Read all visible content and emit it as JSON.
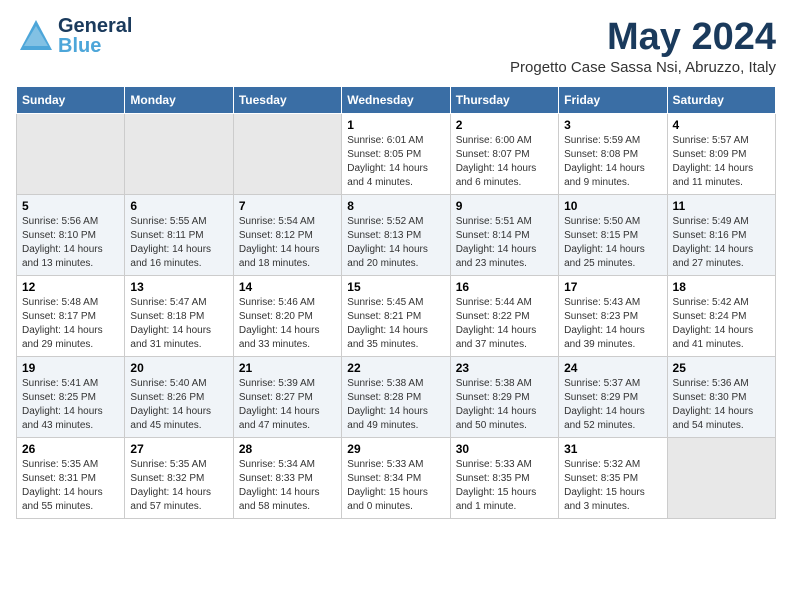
{
  "header": {
    "logo_general": "General",
    "logo_blue": "Blue",
    "month_title": "May 2024",
    "subtitle": "Progetto Case Sassa Nsi, Abruzzo, Italy"
  },
  "weekdays": [
    "Sunday",
    "Monday",
    "Tuesday",
    "Wednesday",
    "Thursday",
    "Friday",
    "Saturday"
  ],
  "weeks": [
    [
      {
        "day": "",
        "sunrise": "",
        "sunset": "",
        "daylight": ""
      },
      {
        "day": "",
        "sunrise": "",
        "sunset": "",
        "daylight": ""
      },
      {
        "day": "",
        "sunrise": "",
        "sunset": "",
        "daylight": ""
      },
      {
        "day": "1",
        "sunrise": "Sunrise: 6:01 AM",
        "sunset": "Sunset: 8:05 PM",
        "daylight": "Daylight: 14 hours and 4 minutes."
      },
      {
        "day": "2",
        "sunrise": "Sunrise: 6:00 AM",
        "sunset": "Sunset: 8:07 PM",
        "daylight": "Daylight: 14 hours and 6 minutes."
      },
      {
        "day": "3",
        "sunrise": "Sunrise: 5:59 AM",
        "sunset": "Sunset: 8:08 PM",
        "daylight": "Daylight: 14 hours and 9 minutes."
      },
      {
        "day": "4",
        "sunrise": "Sunrise: 5:57 AM",
        "sunset": "Sunset: 8:09 PM",
        "daylight": "Daylight: 14 hours and 11 minutes."
      }
    ],
    [
      {
        "day": "5",
        "sunrise": "Sunrise: 5:56 AM",
        "sunset": "Sunset: 8:10 PM",
        "daylight": "Daylight: 14 hours and 13 minutes."
      },
      {
        "day": "6",
        "sunrise": "Sunrise: 5:55 AM",
        "sunset": "Sunset: 8:11 PM",
        "daylight": "Daylight: 14 hours and 16 minutes."
      },
      {
        "day": "7",
        "sunrise": "Sunrise: 5:54 AM",
        "sunset": "Sunset: 8:12 PM",
        "daylight": "Daylight: 14 hours and 18 minutes."
      },
      {
        "day": "8",
        "sunrise": "Sunrise: 5:52 AM",
        "sunset": "Sunset: 8:13 PM",
        "daylight": "Daylight: 14 hours and 20 minutes."
      },
      {
        "day": "9",
        "sunrise": "Sunrise: 5:51 AM",
        "sunset": "Sunset: 8:14 PM",
        "daylight": "Daylight: 14 hours and 23 minutes."
      },
      {
        "day": "10",
        "sunrise": "Sunrise: 5:50 AM",
        "sunset": "Sunset: 8:15 PM",
        "daylight": "Daylight: 14 hours and 25 minutes."
      },
      {
        "day": "11",
        "sunrise": "Sunrise: 5:49 AM",
        "sunset": "Sunset: 8:16 PM",
        "daylight": "Daylight: 14 hours and 27 minutes."
      }
    ],
    [
      {
        "day": "12",
        "sunrise": "Sunrise: 5:48 AM",
        "sunset": "Sunset: 8:17 PM",
        "daylight": "Daylight: 14 hours and 29 minutes."
      },
      {
        "day": "13",
        "sunrise": "Sunrise: 5:47 AM",
        "sunset": "Sunset: 8:18 PM",
        "daylight": "Daylight: 14 hours and 31 minutes."
      },
      {
        "day": "14",
        "sunrise": "Sunrise: 5:46 AM",
        "sunset": "Sunset: 8:20 PM",
        "daylight": "Daylight: 14 hours and 33 minutes."
      },
      {
        "day": "15",
        "sunrise": "Sunrise: 5:45 AM",
        "sunset": "Sunset: 8:21 PM",
        "daylight": "Daylight: 14 hours and 35 minutes."
      },
      {
        "day": "16",
        "sunrise": "Sunrise: 5:44 AM",
        "sunset": "Sunset: 8:22 PM",
        "daylight": "Daylight: 14 hours and 37 minutes."
      },
      {
        "day": "17",
        "sunrise": "Sunrise: 5:43 AM",
        "sunset": "Sunset: 8:23 PM",
        "daylight": "Daylight: 14 hours and 39 minutes."
      },
      {
        "day": "18",
        "sunrise": "Sunrise: 5:42 AM",
        "sunset": "Sunset: 8:24 PM",
        "daylight": "Daylight: 14 hours and 41 minutes."
      }
    ],
    [
      {
        "day": "19",
        "sunrise": "Sunrise: 5:41 AM",
        "sunset": "Sunset: 8:25 PM",
        "daylight": "Daylight: 14 hours and 43 minutes."
      },
      {
        "day": "20",
        "sunrise": "Sunrise: 5:40 AM",
        "sunset": "Sunset: 8:26 PM",
        "daylight": "Daylight: 14 hours and 45 minutes."
      },
      {
        "day": "21",
        "sunrise": "Sunrise: 5:39 AM",
        "sunset": "Sunset: 8:27 PM",
        "daylight": "Daylight: 14 hours and 47 minutes."
      },
      {
        "day": "22",
        "sunrise": "Sunrise: 5:38 AM",
        "sunset": "Sunset: 8:28 PM",
        "daylight": "Daylight: 14 hours and 49 minutes."
      },
      {
        "day": "23",
        "sunrise": "Sunrise: 5:38 AM",
        "sunset": "Sunset: 8:29 PM",
        "daylight": "Daylight: 14 hours and 50 minutes."
      },
      {
        "day": "24",
        "sunrise": "Sunrise: 5:37 AM",
        "sunset": "Sunset: 8:29 PM",
        "daylight": "Daylight: 14 hours and 52 minutes."
      },
      {
        "day": "25",
        "sunrise": "Sunrise: 5:36 AM",
        "sunset": "Sunset: 8:30 PM",
        "daylight": "Daylight: 14 hours and 54 minutes."
      }
    ],
    [
      {
        "day": "26",
        "sunrise": "Sunrise: 5:35 AM",
        "sunset": "Sunset: 8:31 PM",
        "daylight": "Daylight: 14 hours and 55 minutes."
      },
      {
        "day": "27",
        "sunrise": "Sunrise: 5:35 AM",
        "sunset": "Sunset: 8:32 PM",
        "daylight": "Daylight: 14 hours and 57 minutes."
      },
      {
        "day": "28",
        "sunrise": "Sunrise: 5:34 AM",
        "sunset": "Sunset: 8:33 PM",
        "daylight": "Daylight: 14 hours and 58 minutes."
      },
      {
        "day": "29",
        "sunrise": "Sunrise: 5:33 AM",
        "sunset": "Sunset: 8:34 PM",
        "daylight": "Daylight: 15 hours and 0 minutes."
      },
      {
        "day": "30",
        "sunrise": "Sunrise: 5:33 AM",
        "sunset": "Sunset: 8:35 PM",
        "daylight": "Daylight: 15 hours and 1 minute."
      },
      {
        "day": "31",
        "sunrise": "Sunrise: 5:32 AM",
        "sunset": "Sunset: 8:35 PM",
        "daylight": "Daylight: 15 hours and 3 minutes."
      },
      {
        "day": "",
        "sunrise": "",
        "sunset": "",
        "daylight": ""
      }
    ]
  ]
}
